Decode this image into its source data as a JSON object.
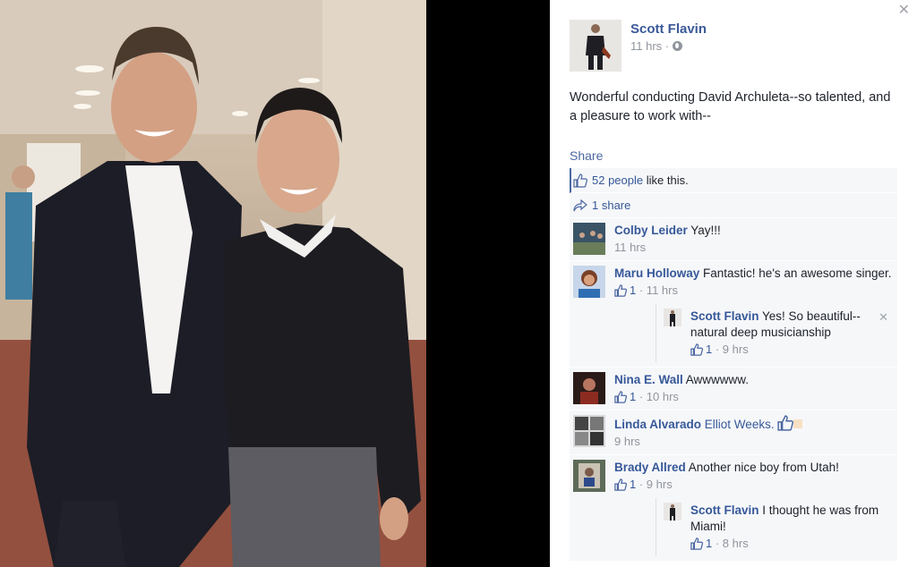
{
  "post": {
    "author": "Scott Flavin",
    "time": "11 hrs ·",
    "text": "Wonderful conducting David Archuleta--so talented, and a pleasure to work with--",
    "share_label": "Share",
    "likes_count": "52 people",
    "likes_suffix": "like this.",
    "shares": "1 share"
  },
  "comments": [
    {
      "author": "Colby Leider",
      "text": "Yay!!!",
      "time": "11 hrs"
    },
    {
      "author": "Maru Holloway",
      "text": "Fantastic! he's an awesome singer.",
      "likes": "1",
      "time": "· 11 hrs",
      "replies": [
        {
          "author": "Scott Flavin",
          "text": "Yes! So beautiful--natural deep musicianship",
          "likes": "1",
          "time": "· 9 hrs"
        }
      ]
    },
    {
      "author": "Nina E. Wall",
      "text": "Awwwwww.",
      "likes": "1",
      "time": "· 10 hrs"
    },
    {
      "author": "Linda Alvarado",
      "mention": "Elliot Weeks.",
      "time": "9 hrs"
    },
    {
      "author": "Brady Allred",
      "text": "Another nice boy from Utah!",
      "likes": "1",
      "time": "· 9 hrs",
      "replies": [
        {
          "author": "Scott Flavin",
          "text": "I thought he was from Miami!",
          "likes": "1",
          "time": "· 8 hrs"
        }
      ]
    }
  ],
  "colors": {
    "link": "#365899",
    "ufi_bg": "#f6f7f9"
  }
}
